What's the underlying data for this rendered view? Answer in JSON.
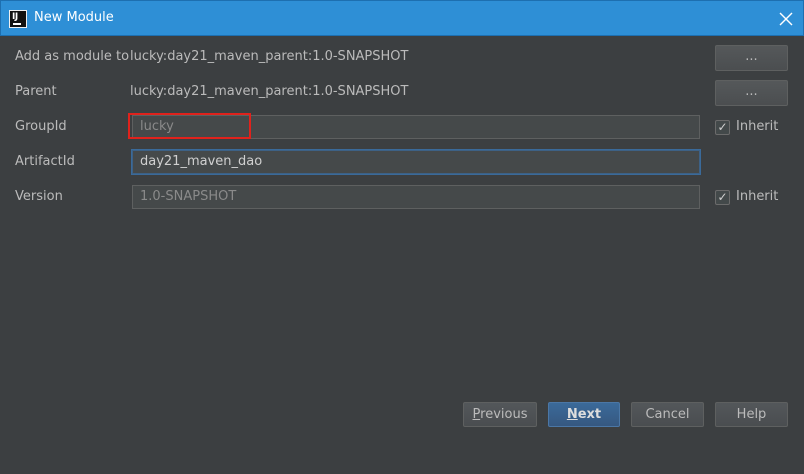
{
  "window": {
    "title": "New Module",
    "app_icon": "intellij-icon",
    "app_icon_text": "IJ"
  },
  "form": {
    "add_as_module_to": {
      "label": "Add as module to",
      "value": "lucky:day21_maven_parent:1.0-SNAPSHOT",
      "button": "..."
    },
    "parent": {
      "label": "Parent",
      "value": "lucky:day21_maven_parent:1.0-SNAPSHOT",
      "button": "..."
    },
    "group_id": {
      "label": "GroupId",
      "value": "lucky",
      "inherit_label": "Inherit",
      "inherit_checked": true
    },
    "artifact_id": {
      "label": "ArtifactId",
      "value": "day21_maven_dao"
    },
    "version": {
      "label": "Version",
      "value": "1.0-SNAPSHOT",
      "inherit_label": "Inherit",
      "inherit_checked": true
    }
  },
  "buttons": {
    "previous_first": "P",
    "previous_rest": "revious",
    "next_first": "N",
    "next_rest": "ext",
    "cancel": "Cancel",
    "help": "Help"
  },
  "colors": {
    "titlebar": "#2e8fd6",
    "background": "#3c3f41",
    "highlight": "#e0221c",
    "primary_button": "#365880"
  }
}
